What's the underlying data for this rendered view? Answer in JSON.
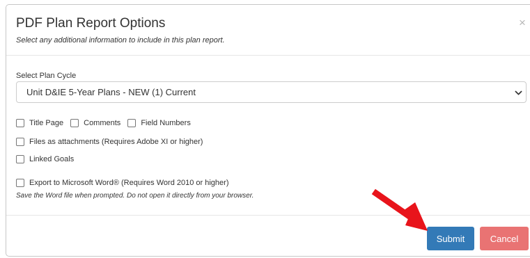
{
  "dialog": {
    "title": "PDF Plan Report Options",
    "subtitle": "Select any additional information to include in this plan report.",
    "close_glyph": "×"
  },
  "plan_cycle": {
    "label": "Select Plan Cycle",
    "selected": "Unit D&IE 5-Year Plans - NEW (1) Current"
  },
  "options": {
    "title_page": {
      "label": "Title Page",
      "checked": false
    },
    "comments": {
      "label": "Comments",
      "checked": false
    },
    "field_numbers": {
      "label": "Field Numbers",
      "checked": false
    },
    "files_attachments": {
      "label": "Files as attachments (Requires Adobe XI or higher)",
      "checked": false
    },
    "linked_goals": {
      "label": "Linked Goals",
      "checked": false
    },
    "export_word": {
      "label": "Export to Microsoft Word® (Requires Word 2010 or higher)",
      "checked": false
    }
  },
  "word_note": "Save the Word file when prompted. Do not open it directly from your browser.",
  "footer": {
    "submit_label": "Submit",
    "cancel_label": "Cancel"
  },
  "colors": {
    "submit": "#337ab7",
    "cancel": "#e97373",
    "annotation_arrow": "#e8141b"
  },
  "icons": {
    "close": "close-icon",
    "select_arrow": "chevron-down-icon",
    "annotation": "red-arrow-icon"
  }
}
